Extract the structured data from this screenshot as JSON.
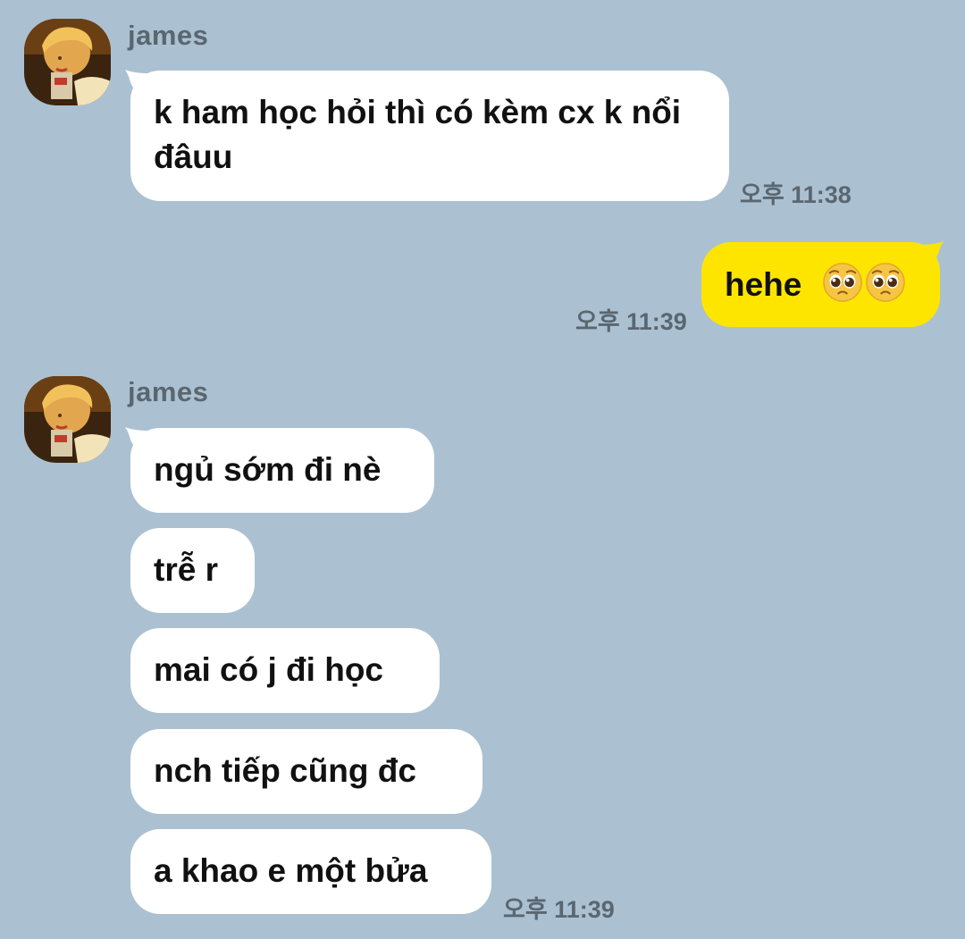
{
  "colors": {
    "background": "#abc1d1",
    "incoming_bubble": "#ffffff",
    "outgoing_bubble": "#fee500",
    "meta_text": "#5a6670"
  },
  "chat": {
    "group1": {
      "sender": "james",
      "message": "k ham học hỏi thì có kèm cx k nổi đâuu",
      "time": "오후 11:38"
    },
    "outgoing": {
      "message": "hehe",
      "emojis": [
        "pleading-face-icon",
        "pleading-face-icon"
      ],
      "time": "오후 11:39"
    },
    "group2": {
      "sender": "james",
      "messages": [
        "ngủ sớm đi nè",
        "trễ r",
        "mai có j đi học",
        "nch tiếp cũng đc",
        "a khao e một bửa"
      ],
      "time": "오후 11:39"
    }
  }
}
